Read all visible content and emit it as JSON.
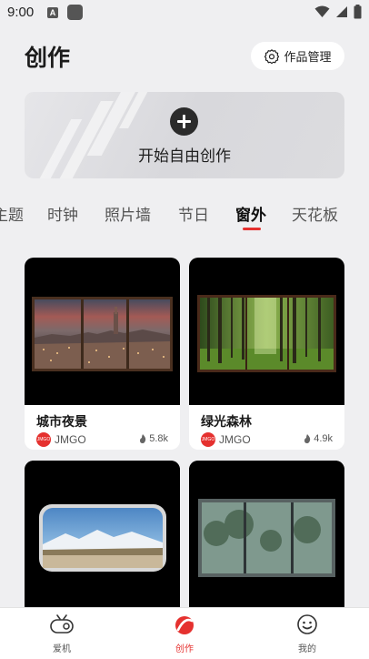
{
  "status_bar": {
    "time": "9:00",
    "notif_letter": "A"
  },
  "header": {
    "title": "创作",
    "manage_label": "作品管理"
  },
  "create_card": {
    "label": "开始自由创作"
  },
  "tabs": [
    {
      "label": "主题"
    },
    {
      "label": "时钟"
    },
    {
      "label": "照片墙"
    },
    {
      "label": "节日"
    },
    {
      "label": "窗外",
      "active": true
    },
    {
      "label": "天花板"
    }
  ],
  "cards": [
    {
      "title": "城市夜景",
      "author": "JMGO",
      "likes": "5.8k"
    },
    {
      "title": "绿光森林",
      "author": "JMGO",
      "likes": "4.9k"
    },
    {
      "title": "",
      "author": "",
      "likes": ""
    },
    {
      "title": "",
      "author": "",
      "likes": ""
    }
  ],
  "brand": {
    "logo_text": "JMGO",
    "accent": "#e5312f"
  },
  "bottom_nav": [
    {
      "label": "爱机",
      "icon": "projector-icon"
    },
    {
      "label": "创作",
      "icon": "create-logo-icon",
      "active": true
    },
    {
      "label": "我的",
      "icon": "smiley-icon"
    }
  ]
}
